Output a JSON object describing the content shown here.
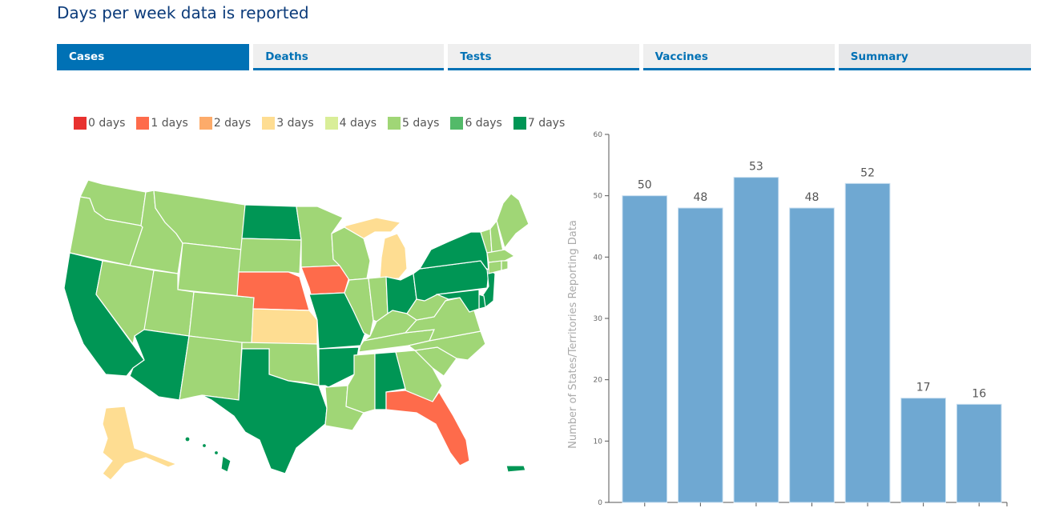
{
  "header": {
    "title": "Days per week data is reported"
  },
  "tabs": [
    {
      "label": "Cases",
      "active": true
    },
    {
      "label": "Deaths",
      "active": false
    },
    {
      "label": "Tests",
      "active": false
    },
    {
      "label": "Vaccines",
      "active": false
    },
    {
      "label": "Summary",
      "active": false
    }
  ],
  "legend": [
    {
      "label": "0 days",
      "color": "#e8312f"
    },
    {
      "label": "1 days",
      "color": "#fe6b4b"
    },
    {
      "label": "2 days",
      "color": "#fdab6a"
    },
    {
      "label": "3 days",
      "color": "#fedd92"
    },
    {
      "label": "4 days",
      "color": "#d9ee98"
    },
    {
      "label": "5 days",
      "color": "#a0d676"
    },
    {
      "label": "6 days",
      "color": "#53ba69"
    },
    {
      "label": "7 days",
      "color": "#009655"
    }
  ],
  "map": {
    "states": {
      "WA": 5,
      "OR": 5,
      "CA": 7,
      "ID": 5,
      "NV": 5,
      "MT": 5,
      "WY": 5,
      "UT": 5,
      "AZ": 7,
      "CO": 5,
      "NM": 5,
      "ND": 7,
      "SD": 5,
      "NE": 1,
      "KS": 3,
      "OK": 5,
      "TX": 7,
      "MN": 5,
      "IA": 1,
      "MO": 7,
      "AR": 7,
      "LA": 5,
      "WI": 5,
      "IL": 5,
      "MI": 3,
      "IN": 5,
      "OH": 7,
      "KY": 5,
      "TN": 5,
      "MS": 5,
      "AL": 7,
      "GA": 5,
      "FL": 1,
      "SC": 5,
      "NC": 5,
      "VA": 5,
      "WV": 5,
      "PA": 7,
      "NY": 7,
      "NJ": 7,
      "DE": 7,
      "MD": 7,
      "VT": 5,
      "NH": 5,
      "ME": 5,
      "MA": 5,
      "CT": 5,
      "RI": 5,
      "AK": 3,
      "HI": 7,
      "PR": 7
    }
  },
  "chart_data": {
    "type": "bar",
    "title": "",
    "xlabel": "",
    "ylabel": "Number of States/Territories Reporting Data",
    "ylim": [
      0,
      60
    ],
    "yticks": [
      0,
      10,
      20,
      30,
      40,
      50,
      60
    ],
    "categories": [
      "",
      "",
      "",
      "",
      "",
      "",
      ""
    ],
    "values": [
      50,
      48,
      53,
      48,
      52,
      17,
      16
    ],
    "bar_color": "#6fa8d2",
    "grid": false
  }
}
